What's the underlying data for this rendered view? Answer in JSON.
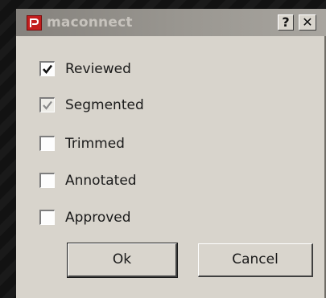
{
  "window": {
    "title": "maconnect",
    "help_label": "?",
    "close_label": "✕"
  },
  "checkboxes": [
    {
      "label": "Reviewed",
      "checked": true,
      "disabled": false
    },
    {
      "label": "Segmented",
      "checked": true,
      "disabled": true
    },
    {
      "label": "Trimmed",
      "checked": false,
      "disabled": false
    },
    {
      "label": "Annotated",
      "checked": false,
      "disabled": false
    },
    {
      "label": "Approved",
      "checked": false,
      "disabled": false
    }
  ],
  "buttons": {
    "ok_label": "Ok",
    "cancel_label": "Cancel"
  },
  "colors": {
    "titlebar": "#9a9791",
    "dialog": "#d8d4cc",
    "app_icon": "#c31d1d"
  }
}
